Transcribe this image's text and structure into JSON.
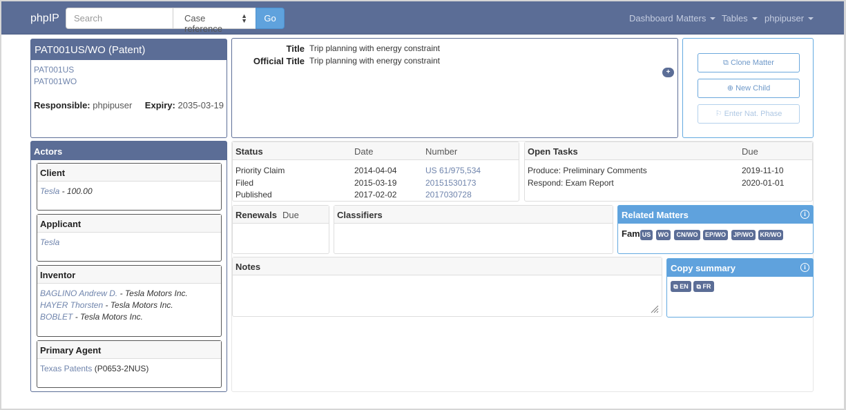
{
  "nav": {
    "brand": "phpIP",
    "search_placeholder": "Search",
    "search_scope": "Case reference",
    "go": "Go",
    "links": [
      {
        "label": "Dashboard"
      },
      {
        "label": "Matters"
      },
      {
        "label": "Tables"
      },
      {
        "label": "phpipuser"
      }
    ]
  },
  "matter": {
    "title": "PAT001US/WO (Patent)",
    "refs": [
      "PAT001US",
      "PAT001WO"
    ],
    "responsible_label": "Responsible:",
    "responsible": "phpipuser",
    "expiry_label": "Expiry:",
    "expiry": "2035-03-19"
  },
  "titles": {
    "title_label": "Title",
    "title": "Trip planning with energy constraint",
    "official_label": "Official Title",
    "official": "Trip planning with energy constraint",
    "add_icon": "plus-icon"
  },
  "actions": {
    "clone": "⧉ Clone Matter",
    "new_child": "⊕ New Child",
    "nat_phase": "⚐ Enter Nat. Phase"
  },
  "actors": {
    "header": "Actors",
    "groups": [
      {
        "role": "Client",
        "entries": [
          {
            "name": "Tesla",
            "extra": " - 100.00"
          }
        ]
      },
      {
        "role": "Applicant",
        "entries": [
          {
            "name": "Tesla",
            "extra": ""
          }
        ]
      },
      {
        "role": "Inventor",
        "entries": [
          {
            "name": "BAGLINO Andrew D.",
            "extra": " - Tesla Motors Inc."
          },
          {
            "name": "HAYER Thorsten",
            "extra": " - Tesla Motors Inc."
          },
          {
            "name": "BOBLET",
            "extra": " - Tesla Motors Inc."
          }
        ]
      },
      {
        "role": "Primary Agent",
        "entries": [
          {
            "name": "Texas Patents",
            "extra": " (P0653-2NUS)"
          }
        ]
      }
    ]
  },
  "status": {
    "headers": [
      "Status",
      "Date",
      "Number"
    ],
    "rows": [
      {
        "event": "Priority Claim",
        "date": "2014-04-04",
        "number": "US 61/975,534"
      },
      {
        "event": "Filed",
        "date": "2015-03-19",
        "number": "20151530173"
      },
      {
        "event": "Published",
        "date": "2017-02-02",
        "number": "2017030728"
      }
    ]
  },
  "tasks": {
    "headers": [
      "Open Tasks",
      "Due"
    ],
    "rows": [
      {
        "task": "Produce: Preliminary Comments",
        "due": "2019-11-10"
      },
      {
        "task": "Respond: Exam Report",
        "due": "2020-01-01"
      }
    ]
  },
  "renewals": {
    "header": "Renewals",
    "due": "Due"
  },
  "classifiers": {
    "header": "Classifiers"
  },
  "related": {
    "header": "Related Matters",
    "family_label": "Fam",
    "badges": [
      "US",
      "WO",
      "CN/WO",
      "EP/WO",
      "JP/WO",
      "KR/WO"
    ]
  },
  "notes": {
    "header": "Notes",
    "value": ""
  },
  "copy": {
    "header": "Copy summary",
    "buttons": [
      "⧉ EN",
      "⧉ FR"
    ]
  },
  "colors": {
    "navbar": "#5b6d96",
    "accent": "#5fa2dd",
    "link": "#6f84ac"
  }
}
